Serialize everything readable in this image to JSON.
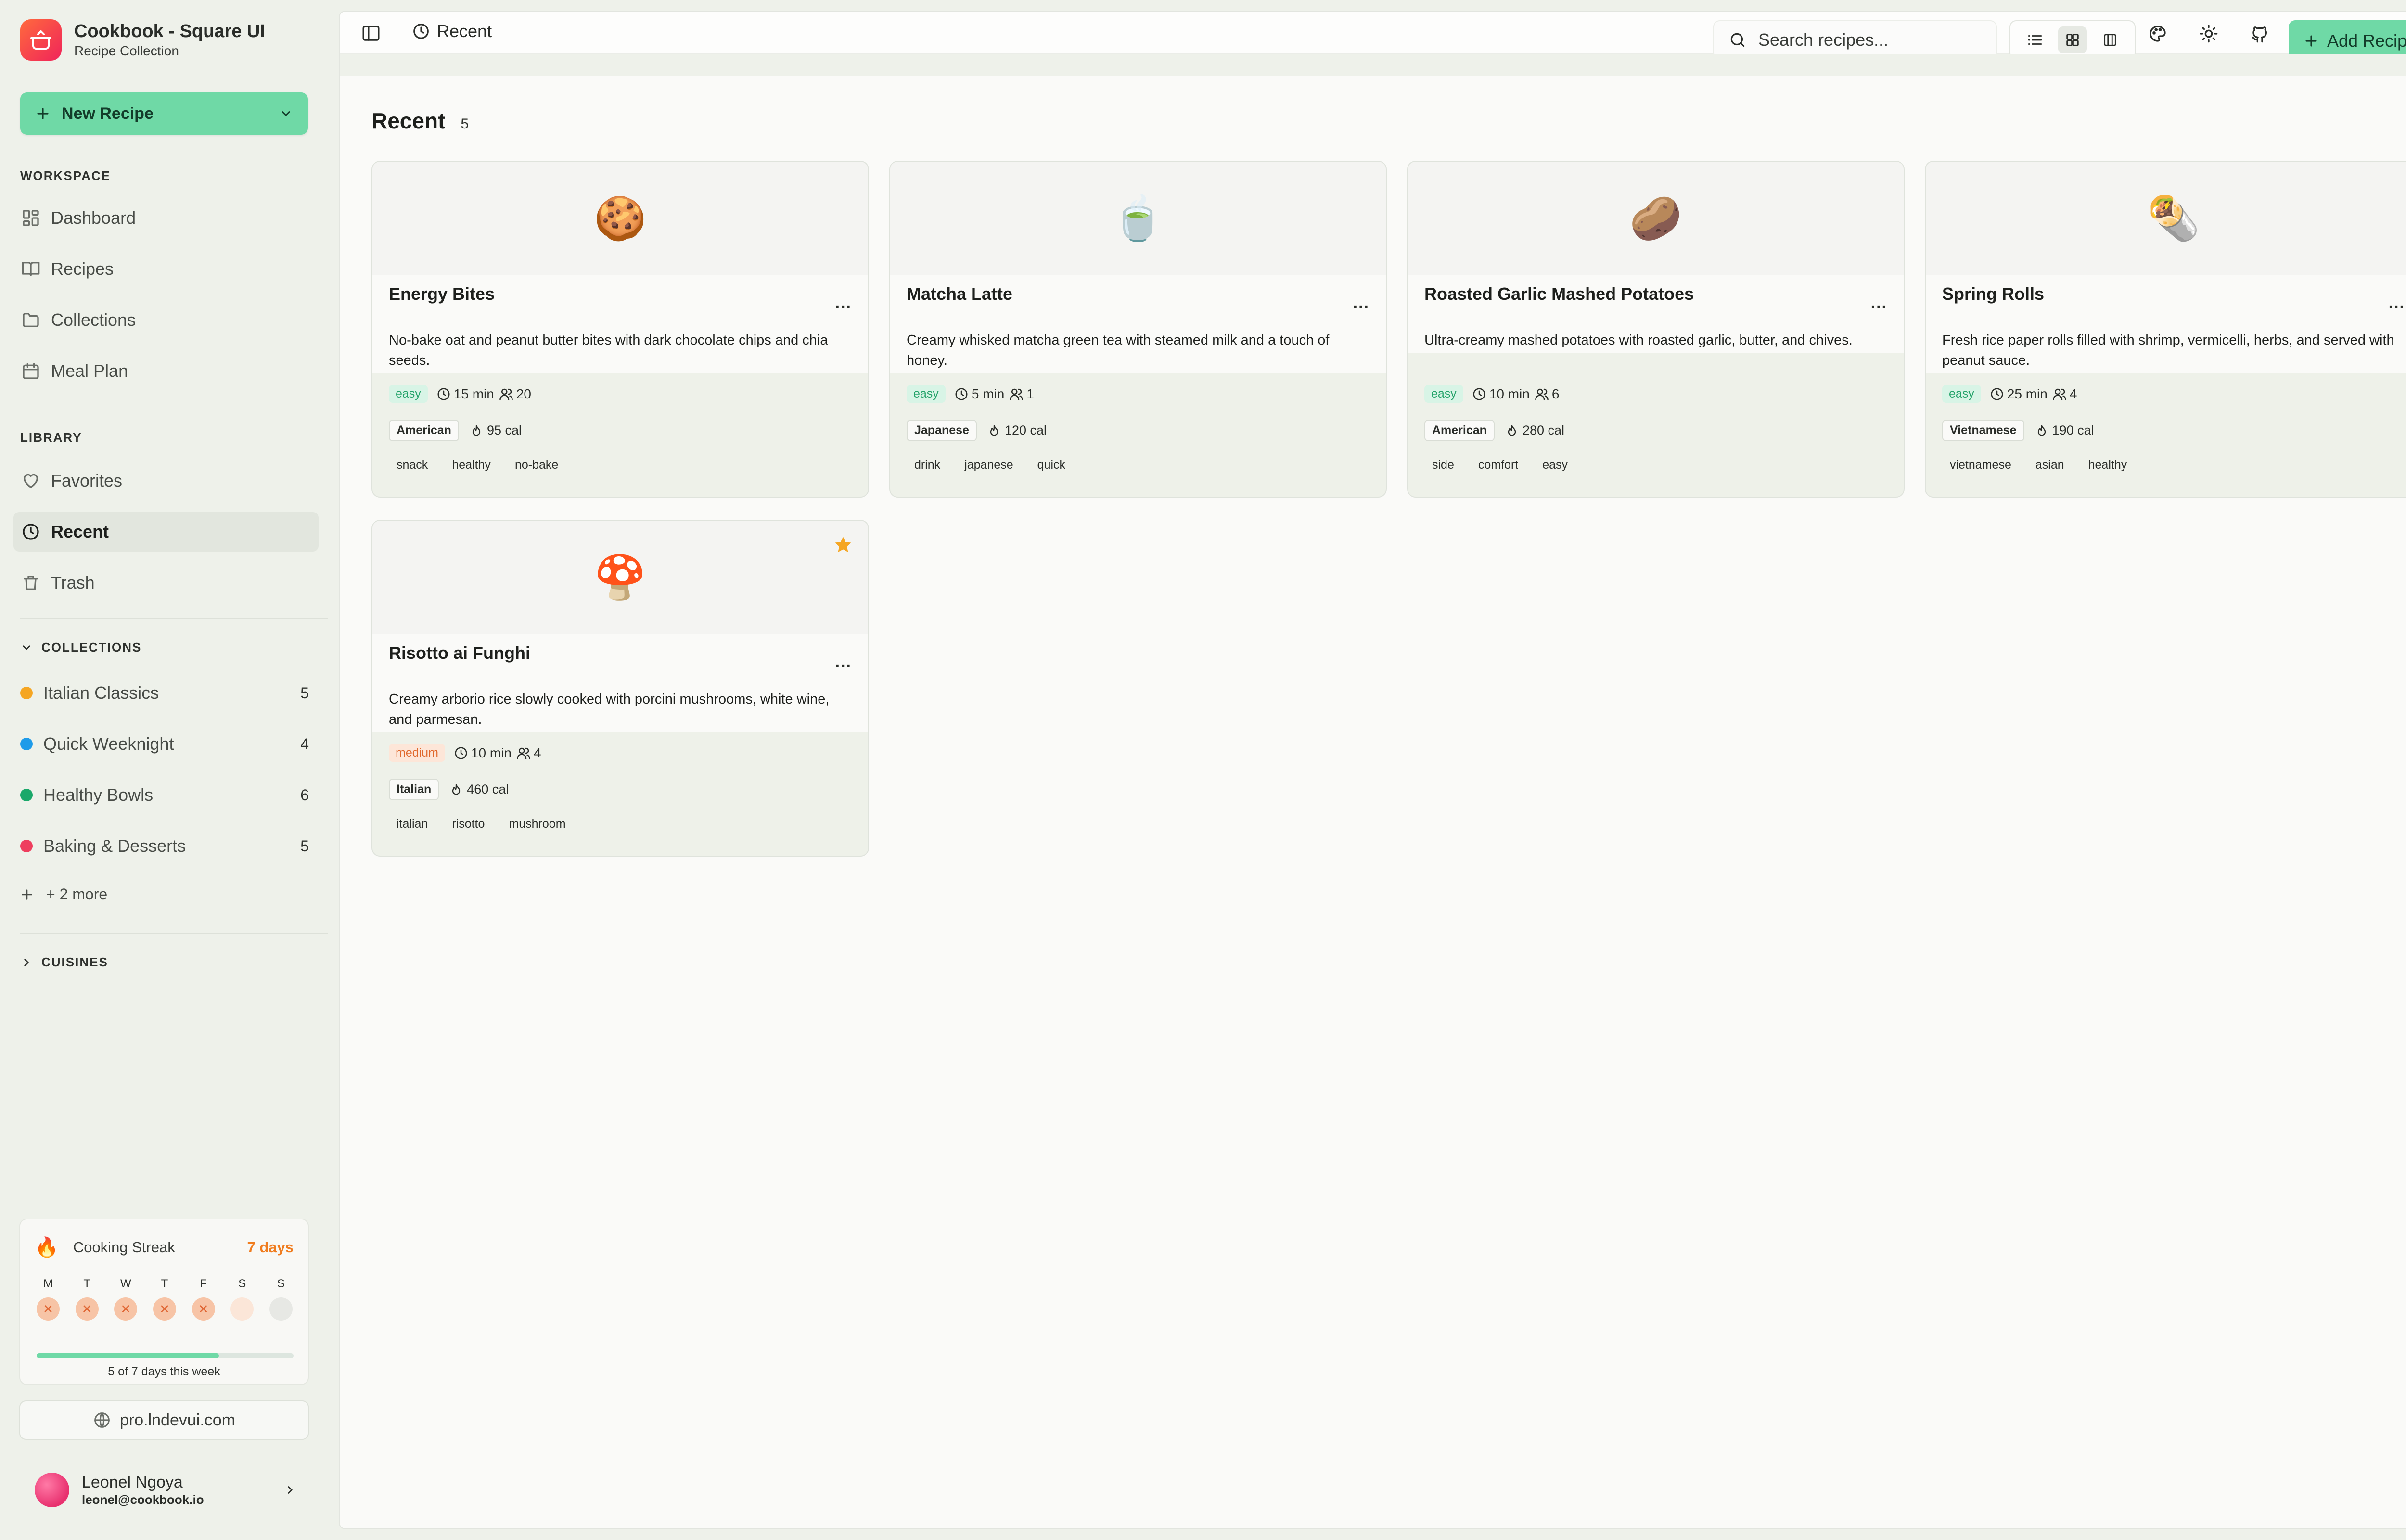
{
  "app": {
    "title": "Cookbook - Square UI",
    "subtitle": "Recipe Collection",
    "new_recipe_label": "New Recipe"
  },
  "sidebar": {
    "workspace_label": "WORKSPACE",
    "workspace_items": [
      {
        "label": "Dashboard",
        "icon": "dashboard-icon"
      },
      {
        "label": "Recipes",
        "icon": "book-icon"
      },
      {
        "label": "Collections",
        "icon": "folder-icon"
      },
      {
        "label": "Meal Plan",
        "icon": "calendar-icon"
      }
    ],
    "library_label": "LIBRARY",
    "library_items": [
      {
        "label": "Favorites",
        "icon": "heart-icon"
      },
      {
        "label": "Recent",
        "icon": "clock-icon",
        "active": true
      },
      {
        "label": "Trash",
        "icon": "trash-icon"
      }
    ],
    "collections_label": "COLLECTIONS",
    "collections": [
      {
        "label": "Italian Classics",
        "count": "5",
        "color": "#f5a623"
      },
      {
        "label": "Quick Weeknight",
        "count": "4",
        "color": "#1e9be9"
      },
      {
        "label": "Healthy Bowls",
        "count": "6",
        "color": "#1aa86a"
      },
      {
        "label": "Baking & Desserts",
        "count": "5",
        "color": "#ee3e5e"
      }
    ],
    "more_label": "+ 2 more",
    "cuisines_label": "CUISINES"
  },
  "streak": {
    "label": "Cooking Streak",
    "days": "7 days",
    "week": [
      "M",
      "T",
      "W",
      "T",
      "F",
      "S",
      "S"
    ],
    "completed": 5,
    "total": 7,
    "progress": 0.71,
    "caption": "5 of 7 days this week"
  },
  "pro_link": "pro.lndevui.com",
  "user": {
    "name": "Leonel Ngoya",
    "email": "leonel@cookbook.io"
  },
  "topbar": {
    "breadcrumb": "Recent",
    "search_placeholder": "Search recipes...",
    "add_recipe_label": "Add Recipe"
  },
  "page": {
    "title": "Recent",
    "count": "5"
  },
  "recipes": [
    {
      "emoji": "🍪",
      "title": "Energy Bites",
      "description": "No-bake oat and peanut butter bites with dark chocolate chips and chia seeds.",
      "difficulty": "easy",
      "time": "15 min",
      "servings": "20",
      "cuisine": "American",
      "calories": "95 cal",
      "tags": [
        "snack",
        "healthy",
        "no-bake"
      ],
      "favorite": false
    },
    {
      "emoji": "🍵",
      "title": "Matcha Latte",
      "description": "Creamy whisked matcha green tea with steamed milk and a touch of honey.",
      "difficulty": "easy",
      "time": "5 min",
      "servings": "1",
      "cuisine": "Japanese",
      "calories": "120 cal",
      "tags": [
        "drink",
        "japanese",
        "quick"
      ],
      "favorite": false
    },
    {
      "emoji": "🥔",
      "title": "Roasted Garlic Mashed Potatoes",
      "description": "Ultra-creamy mashed potatoes with roasted garlic, butter, and chives.",
      "difficulty": "easy",
      "time": "10 min",
      "servings": "6",
      "cuisine": "American",
      "calories": "280 cal",
      "tags": [
        "side",
        "comfort",
        "easy"
      ],
      "favorite": false
    },
    {
      "emoji": "🌯",
      "title": "Spring Rolls",
      "description": "Fresh rice paper rolls filled with shrimp, vermicelli, herbs, and served with peanut sauce.",
      "difficulty": "easy",
      "time": "25 min",
      "servings": "4",
      "cuisine": "Vietnamese",
      "calories": "190 cal",
      "tags": [
        "vietnamese",
        "asian",
        "healthy"
      ],
      "favorite": false
    },
    {
      "emoji": "🍄",
      "title": "Risotto ai Funghi",
      "description": "Creamy arborio rice slowly cooked with porcini mushrooms, white wine, and parmesan.",
      "difficulty": "medium",
      "time": "10 min",
      "servings": "4",
      "cuisine": "Italian",
      "calories": "460 cal",
      "tags": [
        "italian",
        "risotto",
        "mushroom"
      ],
      "favorite": true
    }
  ],
  "colors": {
    "accent": "#6fd9a6",
    "streak": "#f07c1e",
    "star": "#f5a623"
  }
}
